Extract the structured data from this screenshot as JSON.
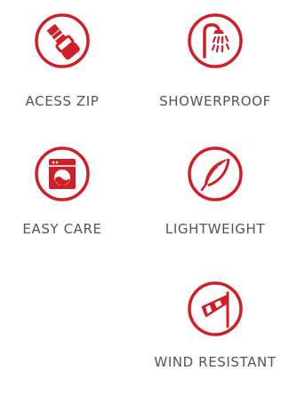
{
  "colors": {
    "accent": "#d01f26",
    "text": "#555555",
    "background": "#ffffff"
  },
  "features": [
    {
      "icon": "zip-icon",
      "label": "ACESS ZIP"
    },
    {
      "icon": "shower-icon",
      "label": "SHOWERPROOF"
    },
    {
      "icon": "washing-machine-icon",
      "label": "EASY CARE"
    },
    {
      "icon": "feather-icon",
      "label": "LIGHTWEIGHT"
    },
    {
      "icon": "windsock-icon",
      "label": "WIND RESISTANT"
    }
  ]
}
